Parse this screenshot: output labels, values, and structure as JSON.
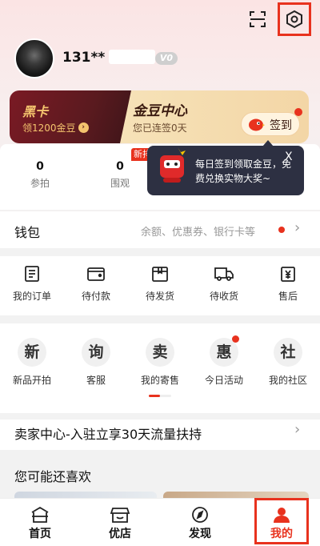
{
  "header": {
    "scan_icon": "scan-icon",
    "settings_icon": "settings-icon"
  },
  "profile": {
    "username": "131**",
    "vip_badge": "V0"
  },
  "black_card": {
    "title": "黑卡",
    "action": "领1200金豆"
  },
  "bean_center": {
    "title": "金豆中心",
    "streak": "您已连签0天",
    "sign_button": "签到"
  },
  "stats": [
    {
      "value": "0",
      "label": "参拍"
    },
    {
      "value": "0",
      "label": "围观"
    }
  ],
  "new_badge": "新排",
  "tooltip": {
    "text": "每日签到领取金豆，免费兑换实物大奖~",
    "close": "X"
  },
  "wallet": {
    "title": "钱包",
    "subtitle": "余额、优惠券、银行卡等"
  },
  "orders": [
    {
      "label": "我的订单",
      "icon": "order-list-icon"
    },
    {
      "label": "待付款",
      "icon": "wallet-icon"
    },
    {
      "label": "待发货",
      "icon": "package-icon"
    },
    {
      "label": "待收货",
      "icon": "truck-icon"
    },
    {
      "label": "售后",
      "icon": "refund-icon"
    }
  ],
  "services": [
    {
      "glyph": "新",
      "label": "新品开拍"
    },
    {
      "glyph": "询",
      "label": "客服"
    },
    {
      "glyph": "卖",
      "label": "我的寄售"
    },
    {
      "glyph": "惠",
      "label": "今日活动"
    },
    {
      "glyph": "社",
      "label": "我的社区"
    }
  ],
  "seller_banner": "卖家中心-入驻立享30天流量扶持",
  "recommend": {
    "title": "您可能还喜欢"
  },
  "tabs": [
    {
      "label": "首页",
      "icon": "home-icon"
    },
    {
      "label": "优店",
      "icon": "shop-icon"
    },
    {
      "label": "发现",
      "icon": "compass-icon"
    },
    {
      "label": "我的",
      "icon": "profile-icon"
    }
  ],
  "colors": {
    "accent": "#e8321e",
    "gold": "#f4c46e",
    "card_dark": "#5a1a1f"
  }
}
